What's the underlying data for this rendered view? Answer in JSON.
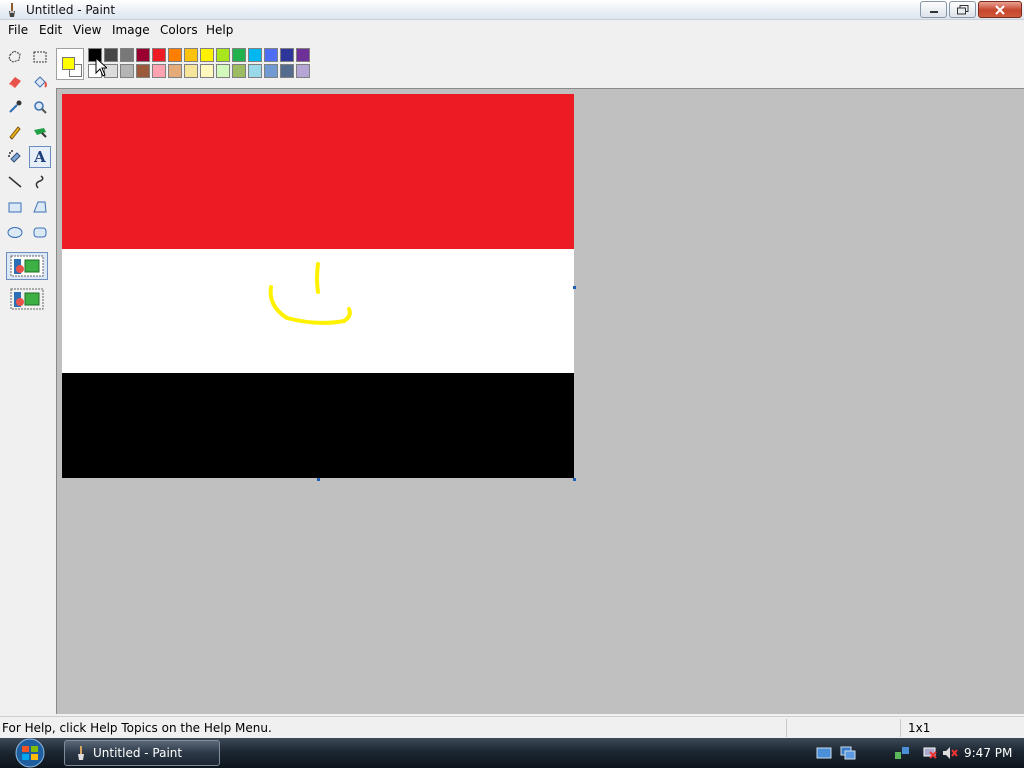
{
  "window": {
    "title": "Untitled - Paint",
    "app_icon": "paint-brush-icon"
  },
  "menu": {
    "items": [
      "File",
      "Edit",
      "View",
      "Image",
      "Colors",
      "Help"
    ]
  },
  "toolbox": {
    "tools": [
      {
        "name": "free-form-select-icon",
        "label": "Free-Form Select"
      },
      {
        "name": "rect-select-icon",
        "label": "Select"
      },
      {
        "name": "eraser-icon",
        "label": "Eraser"
      },
      {
        "name": "fill-bucket-icon",
        "label": "Fill With Color"
      },
      {
        "name": "color-picker-icon",
        "label": "Pick Color"
      },
      {
        "name": "magnifier-icon",
        "label": "Magnifier"
      },
      {
        "name": "pencil-icon",
        "label": "Pencil"
      },
      {
        "name": "brush-icon",
        "label": "Brush"
      },
      {
        "name": "airbrush-icon",
        "label": "Airbrush"
      },
      {
        "name": "text-tool-icon",
        "label": "Text",
        "selected": true
      },
      {
        "name": "line-icon",
        "label": "Line"
      },
      {
        "name": "curve-icon",
        "label": "Curve"
      },
      {
        "name": "rectangle-icon",
        "label": "Rectangle"
      },
      {
        "name": "polygon-icon",
        "label": "Polygon"
      },
      {
        "name": "ellipse-icon",
        "label": "Ellipse"
      },
      {
        "name": "rounded-rect-icon",
        "label": "Rounded Rectangle"
      }
    ],
    "text_tool_letter": "A",
    "options": [
      "opaque-background-icon",
      "transparent-background-icon"
    ]
  },
  "palette": {
    "foreground": "#ffff00",
    "background": "#ffffff",
    "row1": [
      "#000000",
      "#464646",
      "#787878",
      "#990030",
      "#ed1c24",
      "#ff7e00",
      "#ffc20e",
      "#fff200",
      "#a8e61d",
      "#22b14c",
      "#00b7ef",
      "#4d6df3",
      "#2f3699",
      "#6f3198"
    ],
    "row2": [
      "#ffffff",
      "#dcdcdc",
      "#b4b4b4",
      "#9c5a3c",
      "#ffa3b1",
      "#e5aa7a",
      "#f5e49c",
      "#fff9bd",
      "#d3f9bc",
      "#9dbb61",
      "#99d9ea",
      "#709ad1",
      "#546d8e",
      "#b5a5d5"
    ]
  },
  "canvas": {
    "bands": {
      "top": "#ed1c24",
      "middle": "#ffffff",
      "bottom": "#000000"
    },
    "stroke_color": "#fff200"
  },
  "status": {
    "help_text": "For Help, click Help Topics on the Help Menu.",
    "size": "1x1"
  },
  "taskbar": {
    "start_icon": "windows-orb-icon",
    "task_label": "Untitled - Paint",
    "tray_icons": [
      "show-desktop-icon",
      "switch-windows-icon",
      "network-icon",
      "network-disconnected-icon",
      "volume-muted-icon"
    ],
    "clock": "9:47 PM"
  }
}
